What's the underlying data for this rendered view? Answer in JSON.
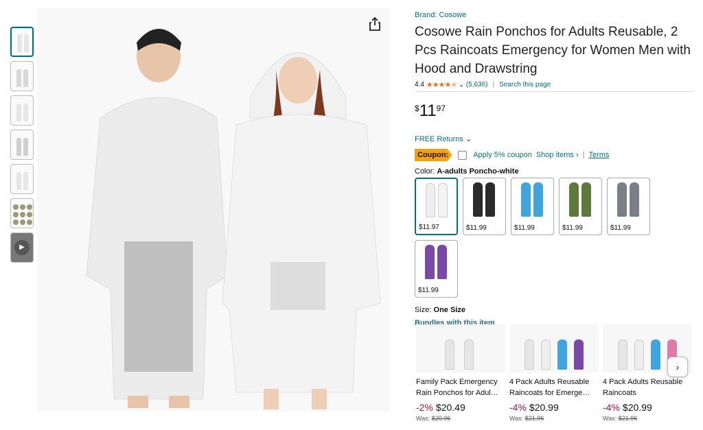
{
  "product": {
    "brand": "Brand: Cosowe",
    "title": "Cosowe Rain Ponchos for Adults Reusable, 2 Pcs Raincoats Emergency for Women Men with Hood and Drawstring",
    "rating_value": "4.4",
    "rating_stars": 4.4,
    "rating_count": "(5,636)",
    "search_page": "Search this page",
    "price_currency": "$",
    "price_whole": "11",
    "price_fraction": "97",
    "free_returns": "FREE Returns",
    "coupon_label": "Coupon:",
    "coupon_text": "Apply 5% coupon",
    "shop_items": "Shop items ›",
    "terms": "Terms",
    "color_label": "Color:",
    "color_value": "A-adults Poncho-white",
    "size_label": "Size:",
    "size_value": "One Size"
  },
  "swatches": [
    {
      "price": "$11.97",
      "color": "#eeeeee"
    },
    {
      "price": "$11.99",
      "color": "#2b2b2b"
    },
    {
      "price": "$11.99",
      "color": "#3fa5dc"
    },
    {
      "price": "$11.99",
      "color": "#5e7a3a"
    },
    {
      "price": "$11.99",
      "color": "#7a7f88"
    },
    {
      "price": "$11.99",
      "color": "#7a48a6"
    }
  ],
  "bundles_heading": "Bundles with this item",
  "bundles": [
    {
      "title": "Family Pack Emergency Rain Ponchos for Adul…",
      "discount": "-2%",
      "price": "$20.49",
      "was_label": "Was:",
      "was": "$20.96"
    },
    {
      "title": "4 Pack Adults Reusable Raincoats for Emerge…",
      "discount": "-4%",
      "price": "$20.99",
      "was_label": "Was:",
      "was": "$21.96"
    },
    {
      "title": "4 Pack Adults Reusable Raincoats",
      "discount": "-4%",
      "price": "$20.99",
      "was_label": "Was:",
      "was": "$21.96"
    }
  ],
  "colors": {
    "link": "#007185",
    "star": "#de7921",
    "coupon": "#f7a20a",
    "discount": "#CC0C39",
    "apply": "#067D62"
  }
}
